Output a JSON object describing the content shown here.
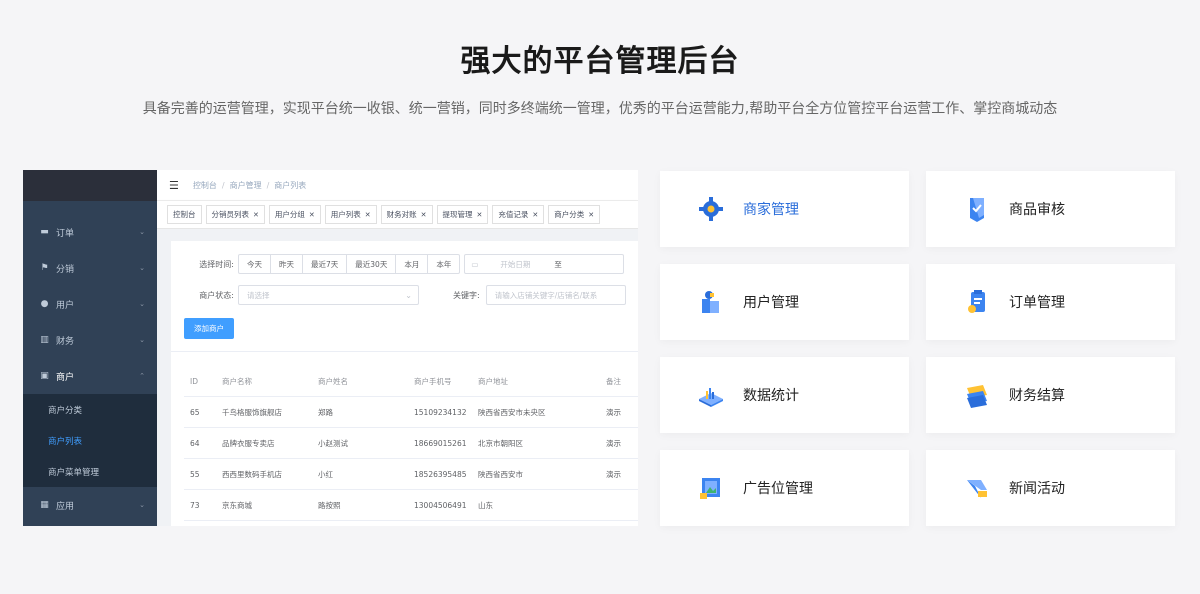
{
  "header": {
    "title": "强大的平台管理后台",
    "subtitle": "具备完善的运营管理，实现平台统一收银、统一营销，同时多终端统一管理，优秀的平台运营能力,帮助平台全方位管控平台运营工作、掌控商城动态"
  },
  "admin": {
    "sidebar": {
      "items": [
        {
          "label": "订单",
          "icon": "briefcase-icon"
        },
        {
          "label": "分销",
          "icon": "flag-icon"
        },
        {
          "label": "用户",
          "icon": "user-icon"
        },
        {
          "label": "财务",
          "icon": "bar-chart-icon"
        },
        {
          "label": "商户",
          "icon": "store-icon"
        }
      ],
      "subitems": [
        "商户分类",
        "商户列表",
        "商户菜单管理"
      ],
      "active_subitem": "商户列表",
      "last_item": {
        "label": "应用",
        "icon": "grid-icon"
      }
    },
    "breadcrumb": [
      "控制台",
      "商户管理",
      "商户列表"
    ],
    "tags": [
      "控制台",
      "分销员列表",
      "用户分组",
      "用户列表",
      "财务对账",
      "提现管理",
      "充值记录",
      "商户分类"
    ],
    "filters": {
      "time_label": "选择时间:",
      "time_options": [
        "今天",
        "昨天",
        "最近7天",
        "最近30天",
        "本月",
        "本年"
      ],
      "date_start_placeholder": "开始日期",
      "date_to": "至",
      "status_label": "商户状态:",
      "status_placeholder": "请选择",
      "keyword_label": "关键字:",
      "keyword_placeholder": "请输入店铺关键字/店铺名/联系"
    },
    "add_button": "添加商户",
    "table": {
      "headers": [
        "ID",
        "商户名称",
        "商户姓名",
        "商户手机号",
        "商户地址",
        "备注"
      ],
      "rows": [
        [
          "65",
          "千鸟格服饰旗舰店",
          "郑路",
          "15109234132",
          "陕西省西安市未央区",
          "演示"
        ],
        [
          "64",
          "品牌衣服专卖店",
          "小赵测试",
          "18669015261",
          "北京市朝阳区",
          "演示"
        ],
        [
          "55",
          "西西里数码手机店",
          "小红",
          "18526395485",
          "陕西省西安市",
          "演示"
        ],
        [
          "73",
          "京东商城",
          "路按照",
          "13004506491",
          "山东",
          ""
        ]
      ]
    }
  },
  "features": [
    {
      "label": "商家管理",
      "icon": "gear-icon",
      "highlight": true
    },
    {
      "label": "商品审核",
      "icon": "shield-check-icon",
      "highlight": false
    },
    {
      "label": "用户管理",
      "icon": "user-blocks-icon",
      "highlight": false
    },
    {
      "label": "订单管理",
      "icon": "clipboard-icon",
      "highlight": false
    },
    {
      "label": "数据统计",
      "icon": "chart-platform-icon",
      "highlight": false
    },
    {
      "label": "财务结算",
      "icon": "cash-icon",
      "highlight": false
    },
    {
      "label": "广告位管理",
      "icon": "billboard-icon",
      "highlight": false
    },
    {
      "label": "新闻活动",
      "icon": "megaphone-icon",
      "highlight": false
    }
  ],
  "colors": {
    "accent": "#409eff",
    "sidebar": "#304156",
    "highlight_text": "#2a6dda"
  }
}
